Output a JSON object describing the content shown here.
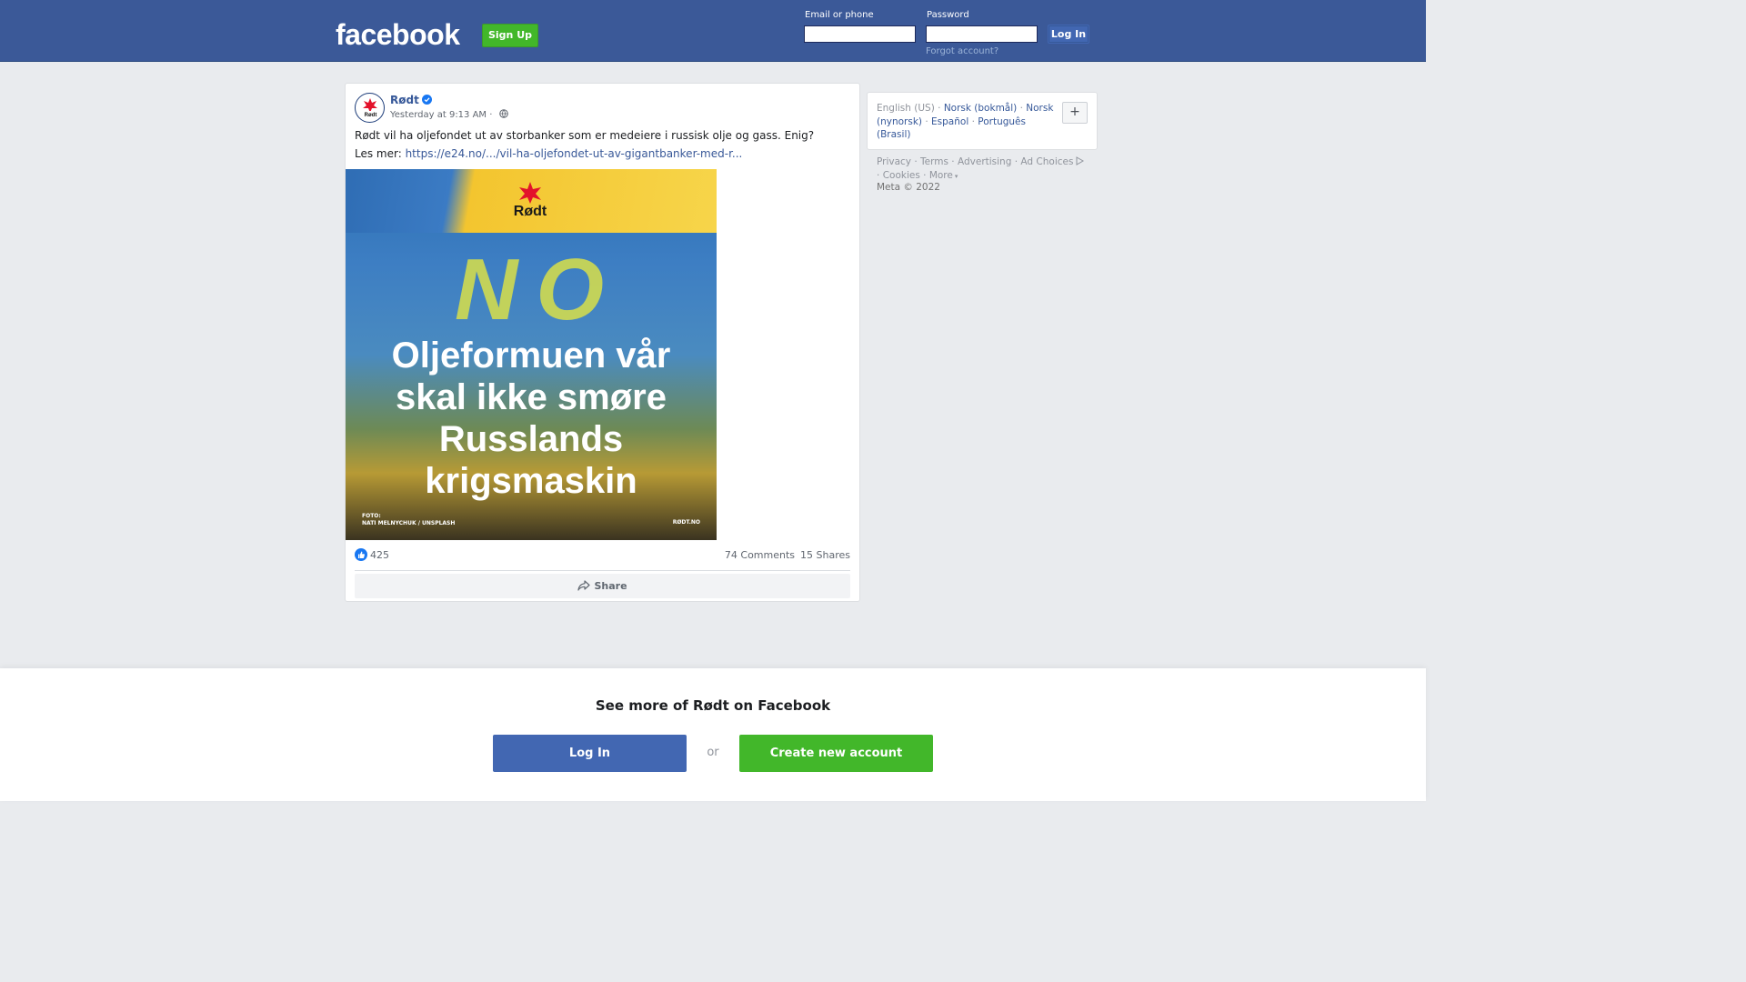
{
  "header": {
    "logo_text": "facebook",
    "signup_label": "Sign Up",
    "email_label": "Email or phone",
    "password_label": "Password",
    "login_label": "Log In",
    "forgot_label": "Forgot account?",
    "bar_color": "#3b5998"
  },
  "post": {
    "author": "Rødt",
    "timestamp": "Yesterday at 9:13 AM · ",
    "text": "Rødt vil ha oljefondet ut av storbanker som er medeiere i russisk olje og gass. Enig?",
    "link_prefix": "Les mer: ",
    "link_text": "https://e24.no/.../vil-ha-oljefondet-ut-av-gigantbanker-med-r...",
    "image": {
      "party_label": "Rødt",
      "scrawl_text": "NO",
      "headline_lines": [
        "Oljeformuen vår",
        "skal ikke smøre",
        "Russlands",
        "krigsmaskin"
      ],
      "credit_line1": "FOTO:",
      "credit_line2": "NATI MELNYCHUK / UNSPLASH",
      "site": "RØDT.NO"
    },
    "reaction_count": "425",
    "comments": "74 Comments",
    "shares": "15 Shares",
    "share_label": "Share"
  },
  "languages": {
    "current": "English (US)",
    "others": [
      "Norsk (bokmål)",
      "Norsk (nynorsk)",
      "Español",
      "Português (Brasil)"
    ],
    "plus_label": "+"
  },
  "footer": {
    "links": [
      "Privacy",
      "Terms",
      "Advertising",
      "Ad Choices",
      "Cookies",
      "More"
    ],
    "meta": "Meta © 2022"
  },
  "banner": {
    "title": "See more of Rødt on Facebook",
    "login_label": "Log In",
    "or_label": "or",
    "create_label": "Create new account"
  },
  "colors": {
    "brand_blue": "#4267b2",
    "green": "#42b72a",
    "link": "#365899"
  }
}
